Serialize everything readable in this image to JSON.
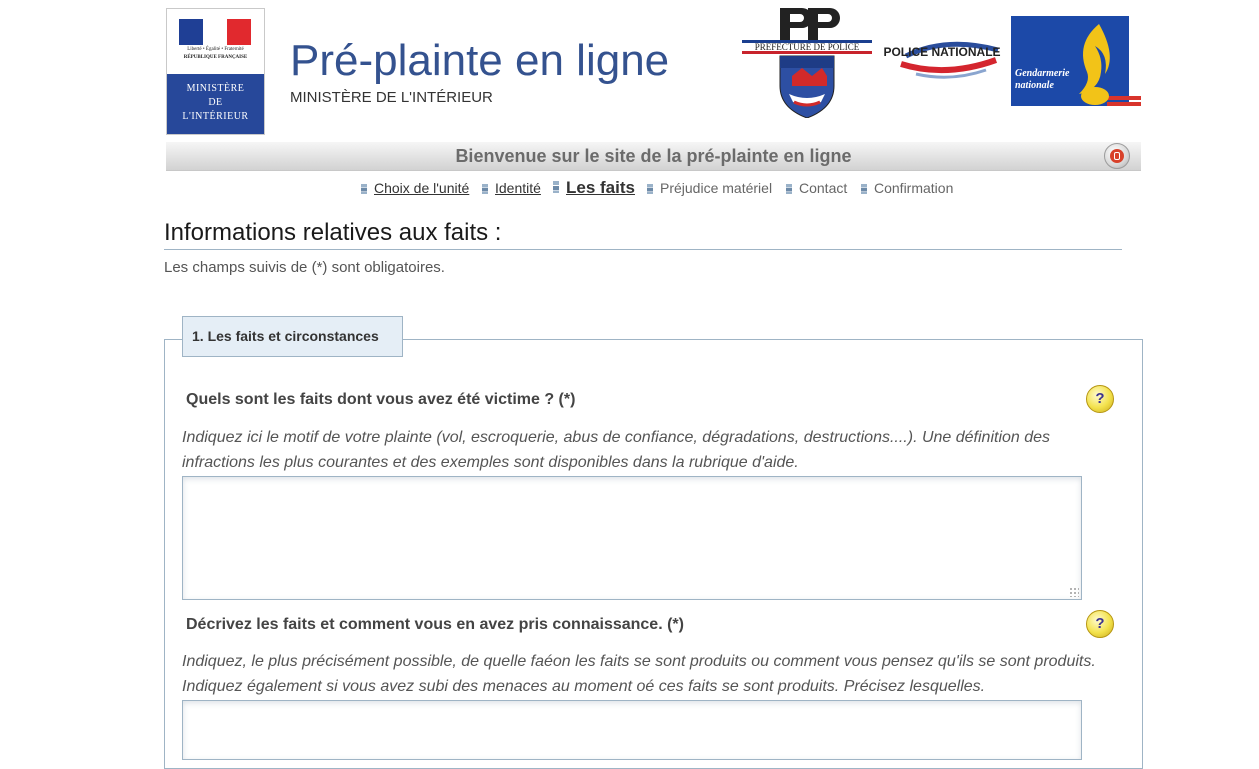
{
  "header": {
    "ministry_logo": {
      "motto": "Liberté • Égalité • Fraternité",
      "republic": "RÉPUBLIQUE FRANÇAISE",
      "text": "MINISTÈRE\nDE\nL'INTÉRIEUR",
      "colors": {
        "blue": "#27489a",
        "flag_blue": "#1f3f95",
        "flag_red": "#e1292e"
      }
    },
    "title": "Pré-plainte en ligne",
    "subtitle": "MINISTÈRE DE L'INTÉRIEUR",
    "logos": {
      "prefecture_text": "PREFECTURE DE POLICE",
      "police_text": "POLICE NATIONALE",
      "gendarmerie_text": [
        "Gendarmerie",
        "nationale"
      ]
    }
  },
  "banner": {
    "welcome": "Bienvenue sur le site de la pré-plainte en ligne",
    "power_icon": "power-icon"
  },
  "steps": [
    {
      "label": "Choix de l'unité",
      "state": "done"
    },
    {
      "label": "Identité",
      "state": "done"
    },
    {
      "label": "Les faits",
      "state": "current"
    },
    {
      "label": "Préjudice matériel",
      "state": "todo"
    },
    {
      "label": "Contact",
      "state": "todo"
    },
    {
      "label": "Confirmation",
      "state": "todo"
    }
  ],
  "main": {
    "heading": "Informations relatives aux faits :",
    "required_note": "Les champs suivis de (*) sont obligatoires.",
    "fieldset": {
      "legend": "1. Les faits et circonstances",
      "questions": [
        {
          "label": "Quels sont les faits dont vous avez été victime ? (*)",
          "hint": "Indiquez ici le motif de votre plainte (vol, escroquerie, abus de confiance, dégradations, destructions....). Une définition des infractions les plus courantes et des exemples sont disponibles dans la rubrique d'aide.",
          "value": "",
          "help_icon": "question-mark-icon"
        },
        {
          "label": "Décrivez les faits et comment vous en avez pris connaissance. (*)",
          "hint": "Indiquez, le plus précisément possible, de quelle faéon les faits se sont produits ou comment vous pensez qu'ils se sont produits. Indiquez également si vous avez subi des menaces au moment oé ces faits se sont produits. Précisez lesquelles.",
          "value": "",
          "help_icon": "question-mark-icon"
        }
      ]
    }
  },
  "colors": {
    "title_blue": "#34528f",
    "border_blue": "#9fb4c5",
    "legend_bg": "#e5eef6"
  }
}
